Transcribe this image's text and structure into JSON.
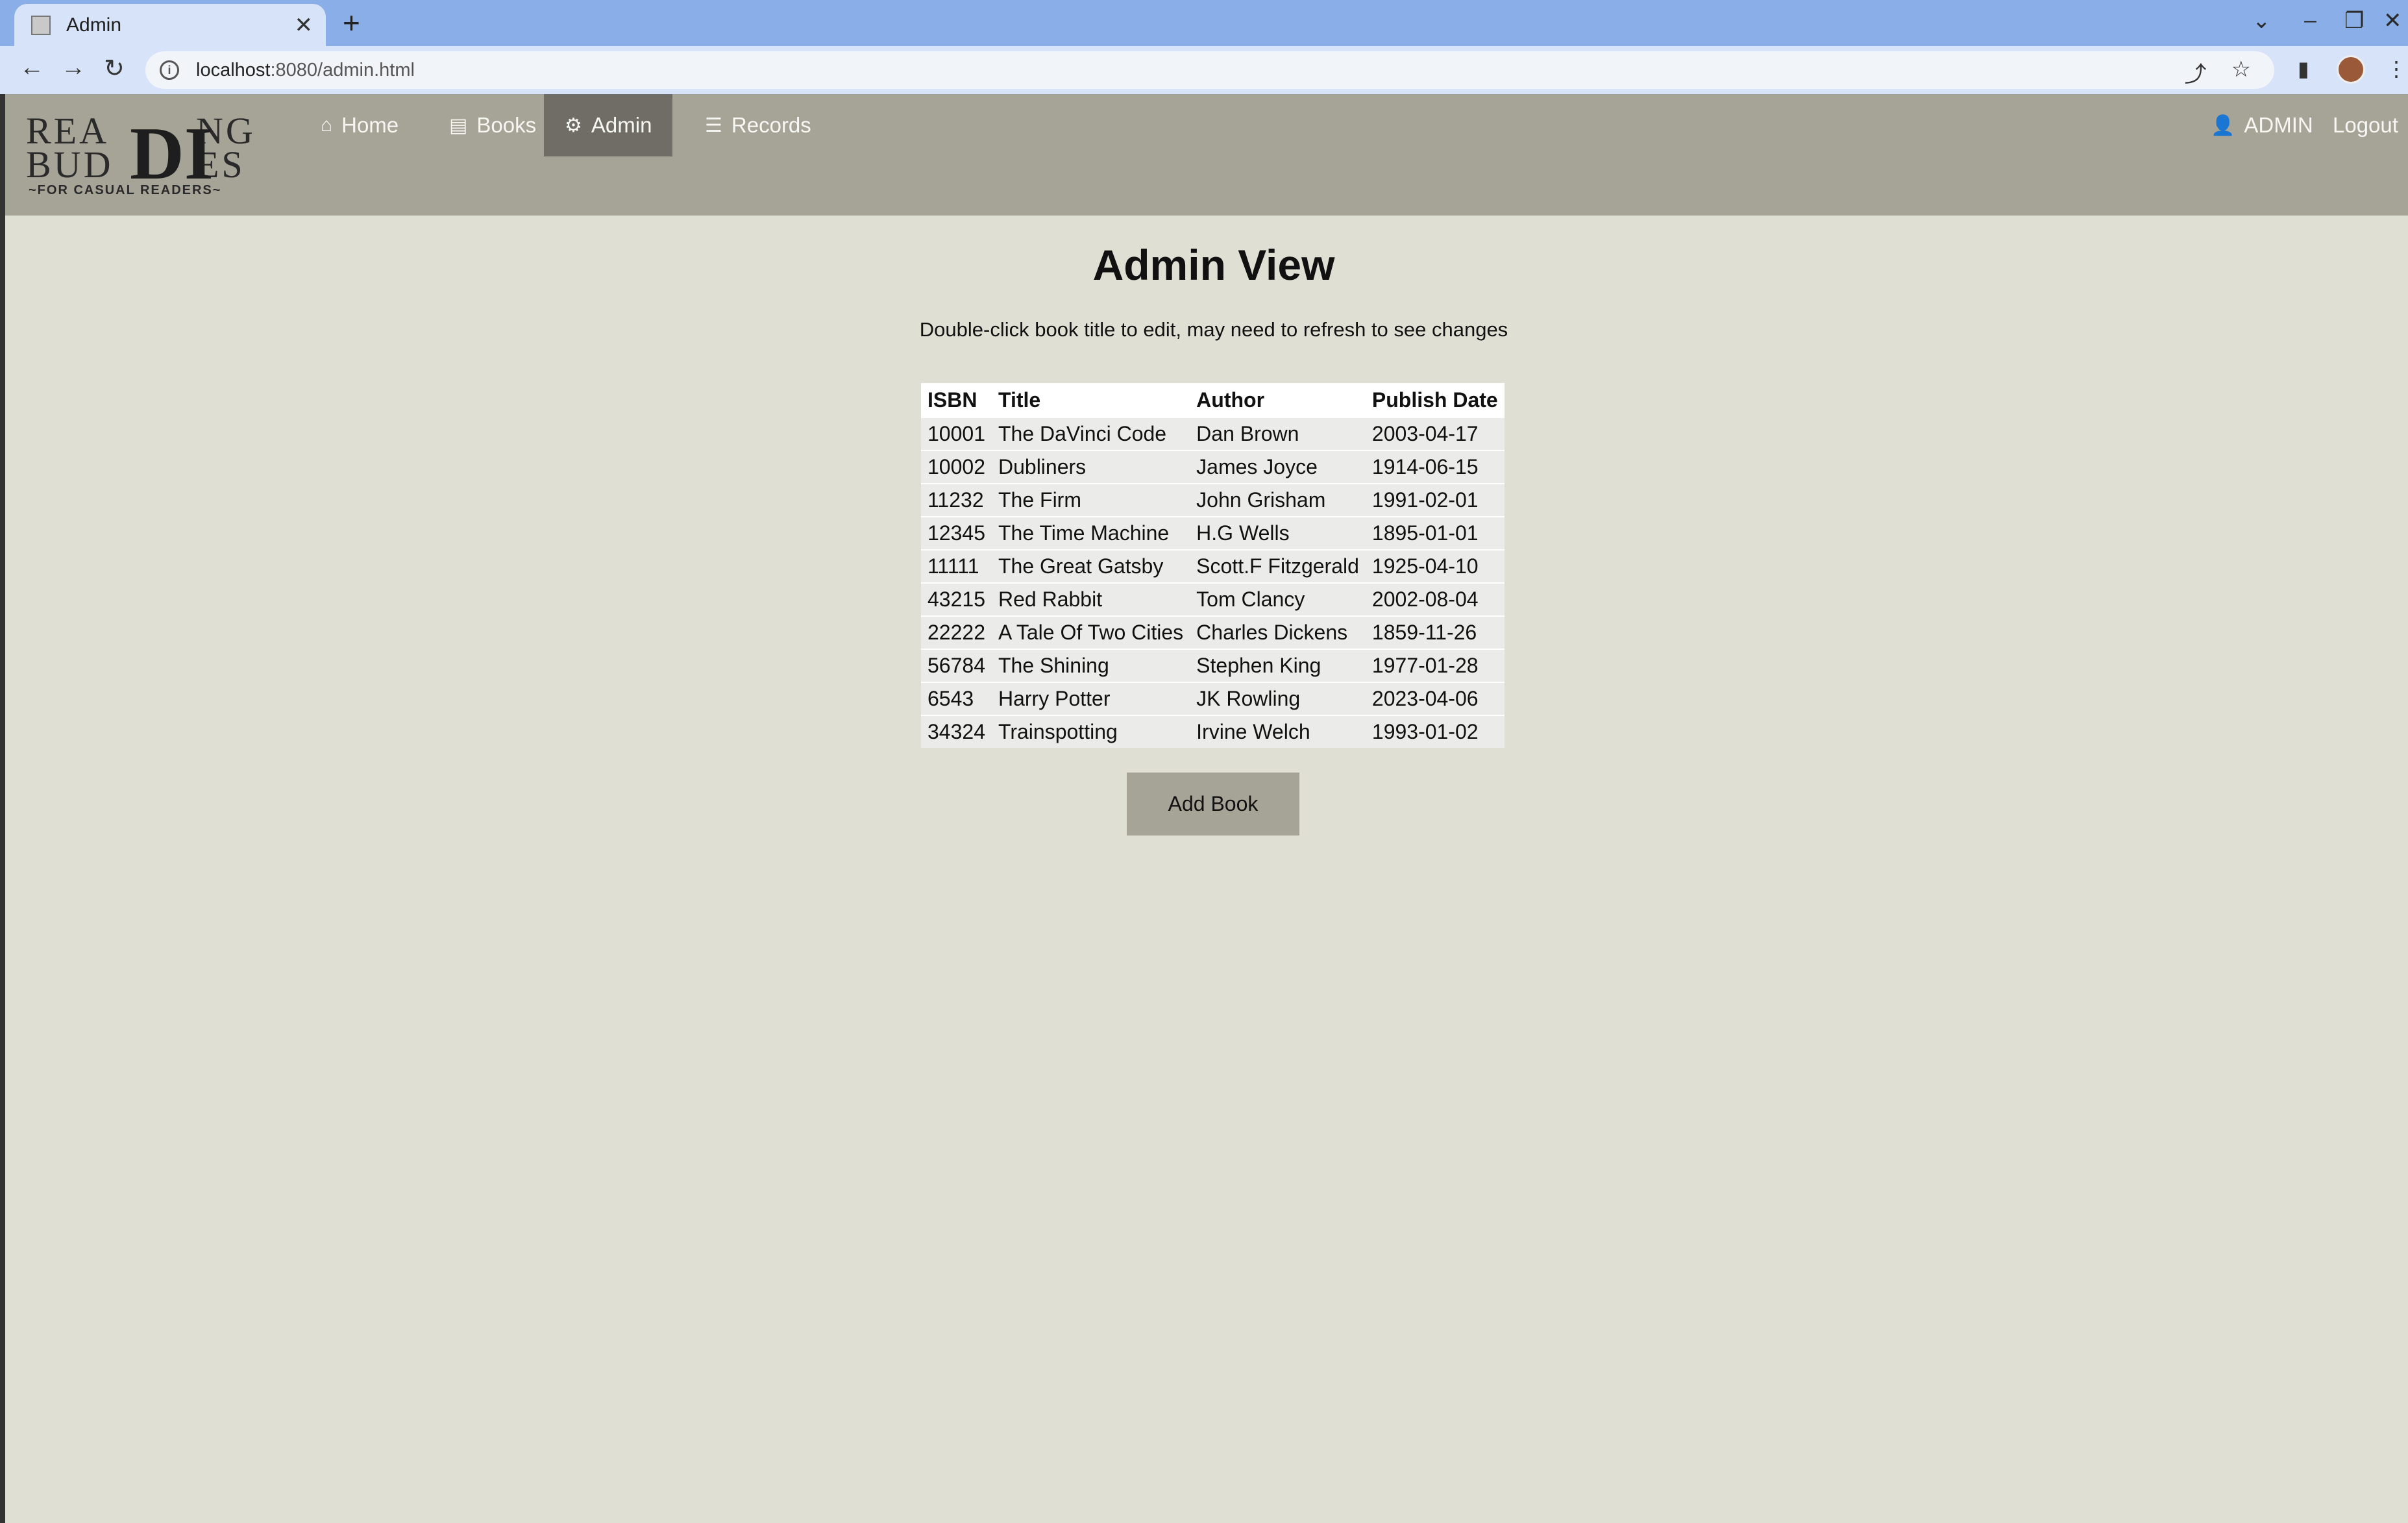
{
  "browser": {
    "tab_title": "Admin",
    "url_host": "localhost",
    "url_path": ":8080/admin.html",
    "new_tab": "+",
    "close_tab": "✕"
  },
  "logo": {
    "line1": "REA",
    "line1b": "NG",
    "line2": "BUD",
    "line2b": "ES",
    "big": "DI",
    "tagline": "~FOR CASUAL READERS~"
  },
  "nav": {
    "home": "Home",
    "books": "Books",
    "admin": "Admin",
    "records": "Records",
    "user": "ADMIN",
    "logout": "Logout"
  },
  "page": {
    "title": "Admin View",
    "subtitle": "Double-click book title to edit, may need to refresh to see changes"
  },
  "table": {
    "headers": [
      "ISBN",
      "Title",
      "Author",
      "Publish Date"
    ],
    "rows": [
      [
        "10001",
        "The DaVinci Code",
        "Dan Brown",
        "2003-04-17"
      ],
      [
        "10002",
        "Dubliners",
        "James Joyce",
        "1914-06-15"
      ],
      [
        "11232",
        "The Firm",
        "John Grisham",
        "1991-02-01"
      ],
      [
        "12345",
        "The Time Machine",
        "H.G Wells",
        "1895-01-01"
      ],
      [
        "11111",
        "The Great Gatsby",
        "Scott.F Fitzgerald",
        "1925-04-10"
      ],
      [
        "43215",
        "Red Rabbit",
        "Tom Clancy",
        "2002-08-04"
      ],
      [
        "22222",
        "A Tale Of Two Cities",
        "Charles Dickens",
        "1859-11-26"
      ],
      [
        "56784",
        "The Shining",
        "Stephen King",
        "1977-01-28"
      ],
      [
        "6543",
        "Harry Potter",
        "JK Rowling",
        "2023-04-06"
      ],
      [
        "34324",
        "Trainspotting",
        "Irvine Welch",
        "1993-01-02"
      ]
    ]
  },
  "add_button": "Add Book",
  "colors": {
    "page_bg": "#e0dfd3",
    "navbar": "#a6a397",
    "nav_active": "#6f6d66",
    "tabstrip": "#8aaee8"
  }
}
